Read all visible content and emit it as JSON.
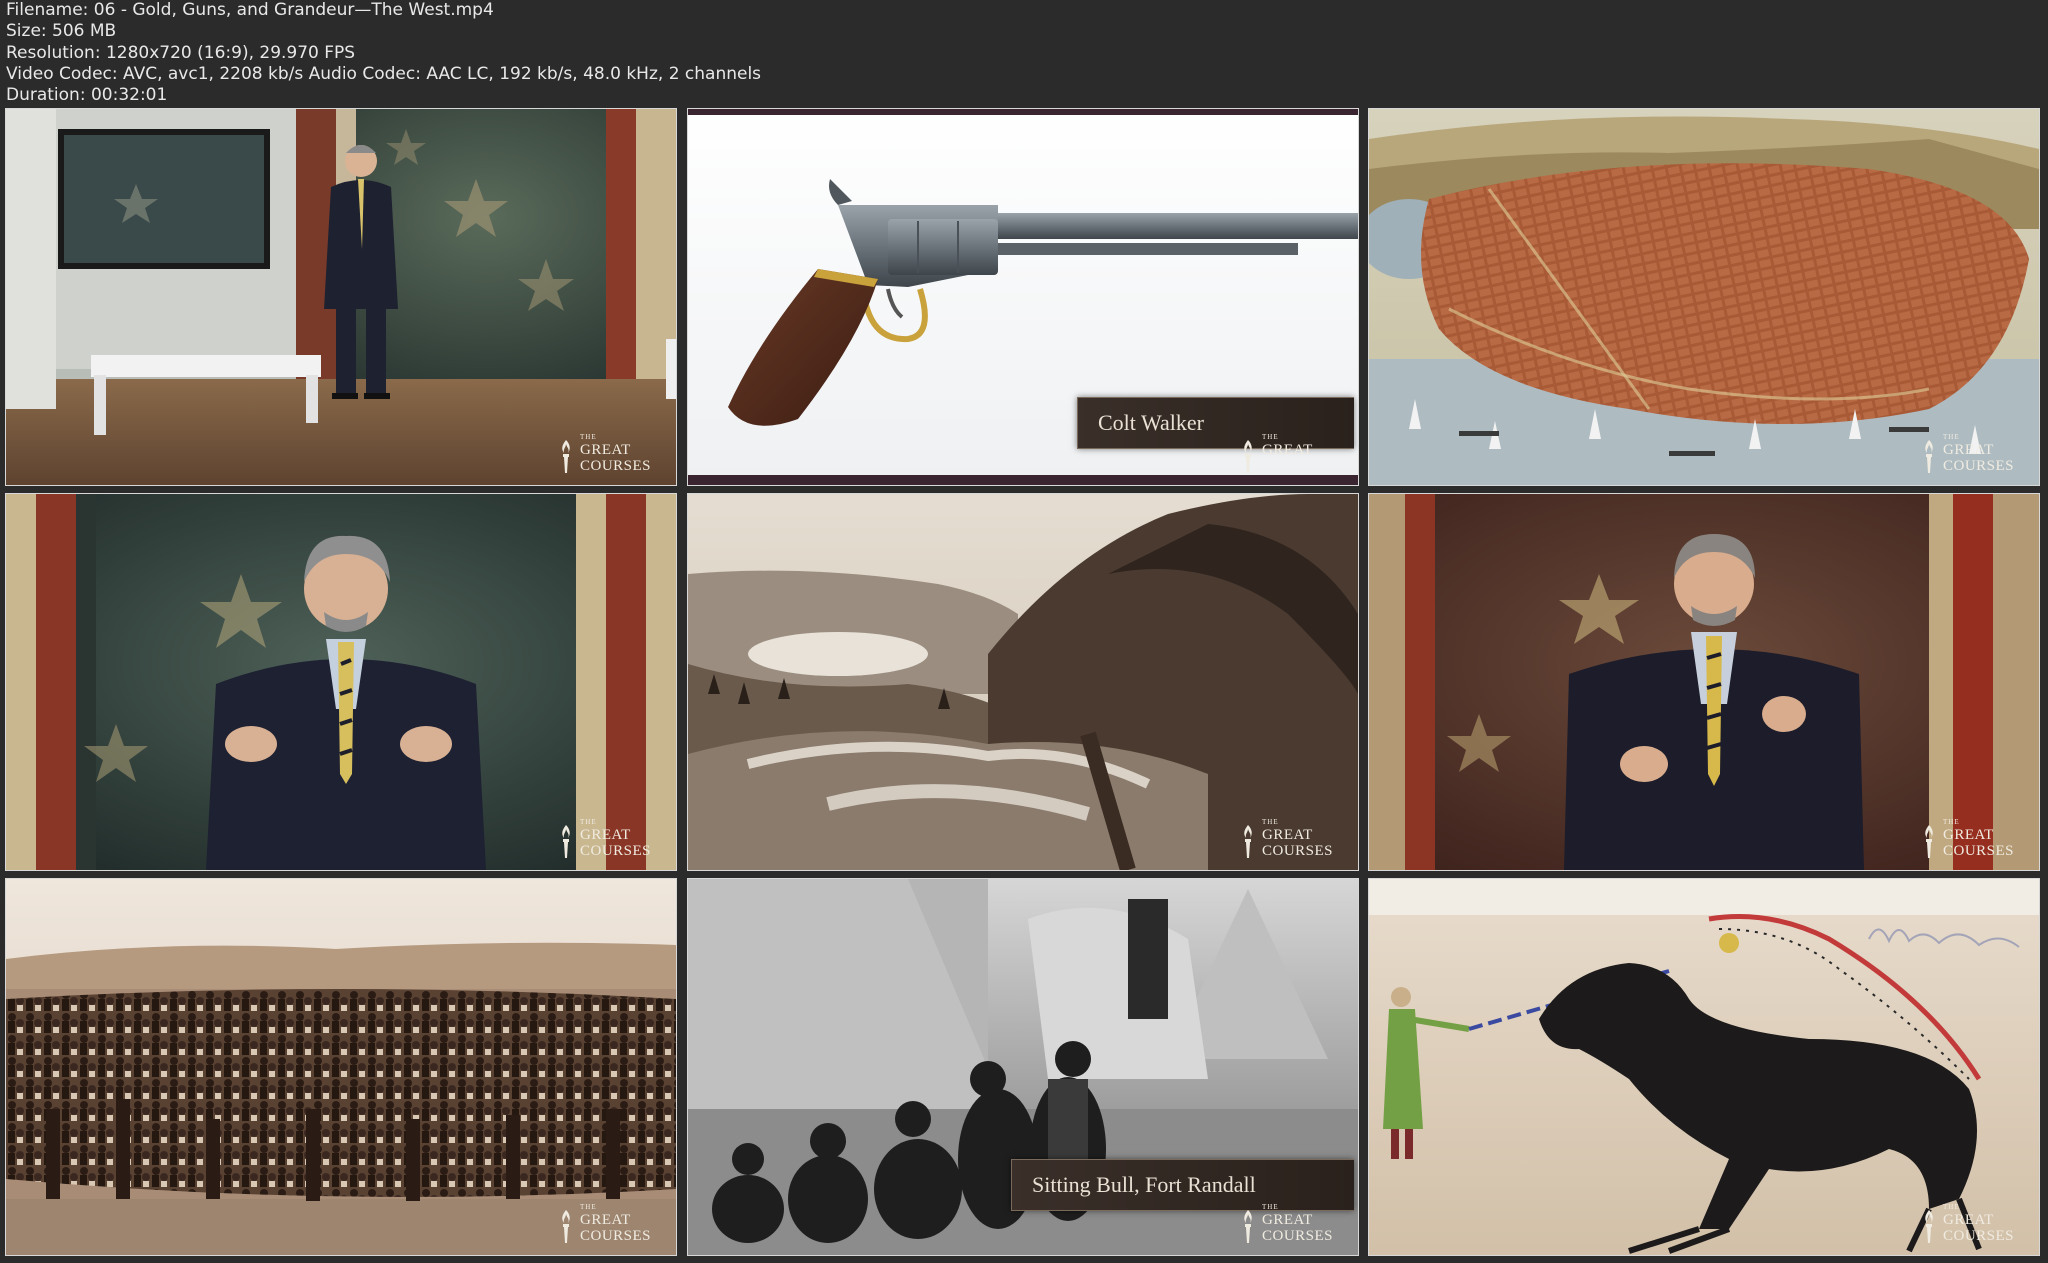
{
  "info": {
    "filename": "Filename: 06 - Gold, Guns, and Grandeur—The West.mp4",
    "size": "Size: 506 MB",
    "resolution": "Resolution: 1280x720 (16:9), 29.970 FPS",
    "codec": "Video Codec: AVC, avc1, 2208 kb/s Audio Codec: AAC LC, 192 kb/s, 48.0 kHz, 2 channels",
    "duration": "Duration: 00:32:01"
  },
  "logo": {
    "the": "THE",
    "line1": "GREAT",
    "line2": "COURSES"
  },
  "captions": {
    "frame2": "Colt Walker",
    "frame8": "Sitting Bull, Fort Randall"
  },
  "frames": [
    {
      "id": "frame1",
      "scene": "lecturer-studio-wide"
    },
    {
      "id": "frame2",
      "scene": "revolver"
    },
    {
      "id": "frame3",
      "scene": "city-bird-view-map"
    },
    {
      "id": "frame4",
      "scene": "lecturer-closeup"
    },
    {
      "id": "frame5",
      "scene": "mountain-lake-photo"
    },
    {
      "id": "frame6",
      "scene": "lecturer-closeup-warm"
    },
    {
      "id": "frame7",
      "scene": "crowd-photo"
    },
    {
      "id": "frame8",
      "scene": "tipi-group-photo"
    },
    {
      "id": "frame9",
      "scene": "ledger-drawing-horse"
    }
  ],
  "colors": {
    "background": "#2b2b2b",
    "text": "#e8e8e8",
    "border": "#d8d8d8"
  }
}
